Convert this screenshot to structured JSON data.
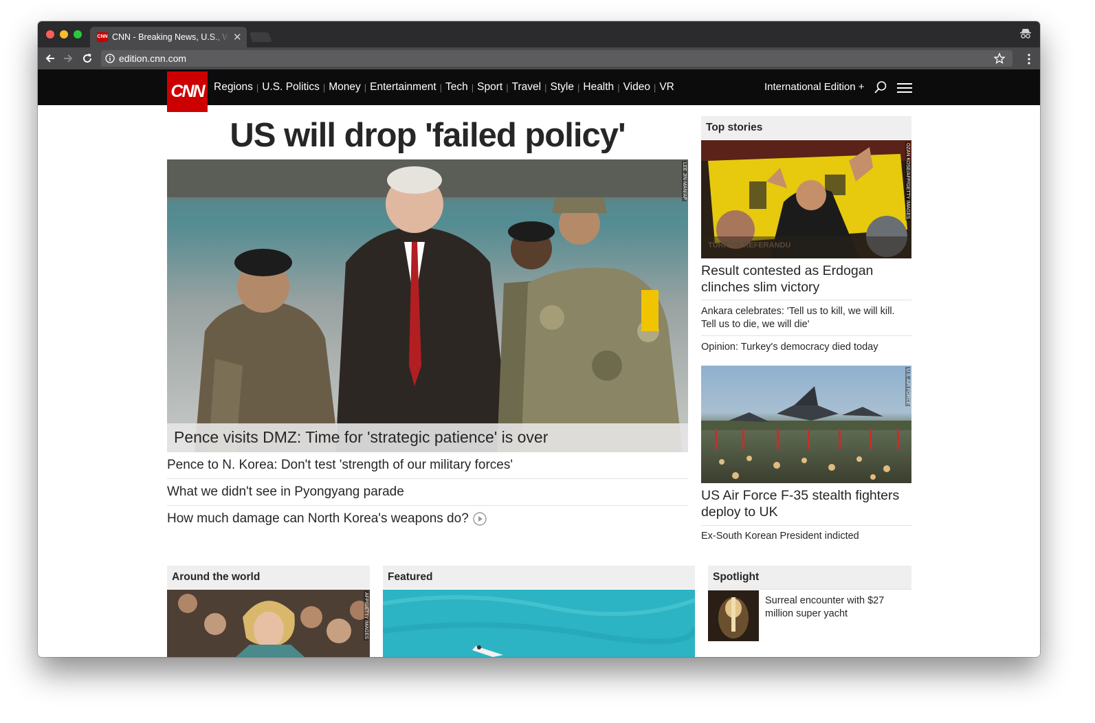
{
  "browser": {
    "tab_title": "CNN - Breaking News, U.S., World",
    "favicon_text": "CNN",
    "url": "edition.cnn.com"
  },
  "header": {
    "logo_text": "CNN",
    "nav": [
      "Regions",
      "U.S. Politics",
      "Money",
      "Entertainment",
      "Tech",
      "Sport",
      "Travel",
      "Style",
      "Health",
      "Video",
      "VR"
    ],
    "edition": "International Edition +",
    "brand_color": "#cc0000"
  },
  "main": {
    "headline": "US will drop 'failed policy'",
    "hero_caption": "Pence visits DMZ: Time for 'strategic patience' is over",
    "hero_credit": "LEE JIN-MAN/AP",
    "related": [
      "Pence to N. Korea: Don't test 'strength of our military forces'",
      "What we didn't see in Pyongyang parade",
      "How much damage can North Korea's weapons do?"
    ]
  },
  "top_stories": {
    "title": "Top stories",
    "story1": {
      "headline": "Result contested as Erdogan clinches slim victory",
      "img_text": "TÜRKİYE REFERANDU",
      "credit": "OZAN KOSE/AFP/GETTY IMAGES",
      "subs": [
        "Ankara celebrates: 'Tell us to kill, we will kill. Tell us to die, we will die'",
        "Opinion: Turkey's democracy died today"
      ]
    },
    "story2": {
      "headline": "US Air Force F-35 stealth fighters deploy to UK",
      "credit": "U.S. AIR FORCE",
      "subs": [
        "Ex-South Korean President indicted"
      ]
    }
  },
  "bottom": {
    "around": {
      "title": "Around the world",
      "credit": "AFP/GETTY IMAGES"
    },
    "featured": {
      "title": "Featured"
    },
    "spotlight": {
      "title": "Spotlight",
      "text": "Surreal encounter with $27 million super yacht"
    }
  }
}
